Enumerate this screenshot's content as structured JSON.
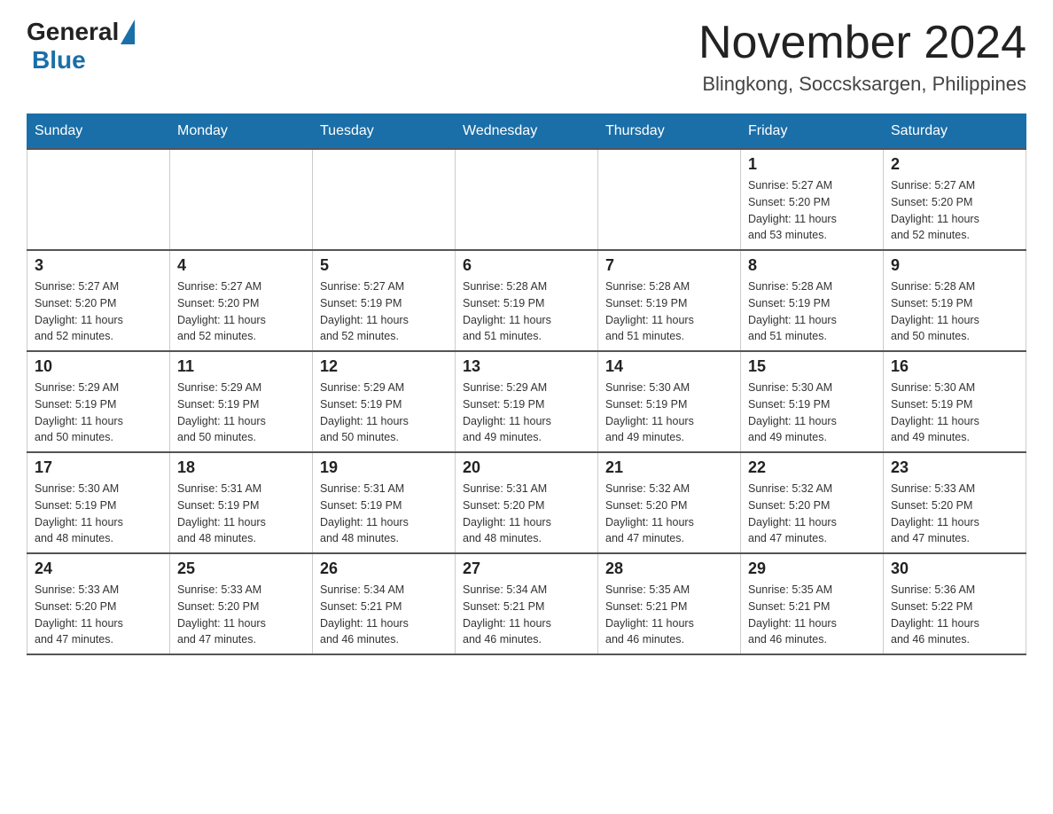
{
  "header": {
    "title": "November 2024",
    "subtitle": "Blingkong, Soccsksargen, Philippines",
    "logo_general": "General",
    "logo_blue": "Blue"
  },
  "weekdays": [
    "Sunday",
    "Monday",
    "Tuesday",
    "Wednesday",
    "Thursday",
    "Friday",
    "Saturday"
  ],
  "weeks": [
    [
      {
        "day": "",
        "info": ""
      },
      {
        "day": "",
        "info": ""
      },
      {
        "day": "",
        "info": ""
      },
      {
        "day": "",
        "info": ""
      },
      {
        "day": "",
        "info": ""
      },
      {
        "day": "1",
        "info": "Sunrise: 5:27 AM\nSunset: 5:20 PM\nDaylight: 11 hours\nand 53 minutes."
      },
      {
        "day": "2",
        "info": "Sunrise: 5:27 AM\nSunset: 5:20 PM\nDaylight: 11 hours\nand 52 minutes."
      }
    ],
    [
      {
        "day": "3",
        "info": "Sunrise: 5:27 AM\nSunset: 5:20 PM\nDaylight: 11 hours\nand 52 minutes."
      },
      {
        "day": "4",
        "info": "Sunrise: 5:27 AM\nSunset: 5:20 PM\nDaylight: 11 hours\nand 52 minutes."
      },
      {
        "day": "5",
        "info": "Sunrise: 5:27 AM\nSunset: 5:19 PM\nDaylight: 11 hours\nand 52 minutes."
      },
      {
        "day": "6",
        "info": "Sunrise: 5:28 AM\nSunset: 5:19 PM\nDaylight: 11 hours\nand 51 minutes."
      },
      {
        "day": "7",
        "info": "Sunrise: 5:28 AM\nSunset: 5:19 PM\nDaylight: 11 hours\nand 51 minutes."
      },
      {
        "day": "8",
        "info": "Sunrise: 5:28 AM\nSunset: 5:19 PM\nDaylight: 11 hours\nand 51 minutes."
      },
      {
        "day": "9",
        "info": "Sunrise: 5:28 AM\nSunset: 5:19 PM\nDaylight: 11 hours\nand 50 minutes."
      }
    ],
    [
      {
        "day": "10",
        "info": "Sunrise: 5:29 AM\nSunset: 5:19 PM\nDaylight: 11 hours\nand 50 minutes."
      },
      {
        "day": "11",
        "info": "Sunrise: 5:29 AM\nSunset: 5:19 PM\nDaylight: 11 hours\nand 50 minutes."
      },
      {
        "day": "12",
        "info": "Sunrise: 5:29 AM\nSunset: 5:19 PM\nDaylight: 11 hours\nand 50 minutes."
      },
      {
        "day": "13",
        "info": "Sunrise: 5:29 AM\nSunset: 5:19 PM\nDaylight: 11 hours\nand 49 minutes."
      },
      {
        "day": "14",
        "info": "Sunrise: 5:30 AM\nSunset: 5:19 PM\nDaylight: 11 hours\nand 49 minutes."
      },
      {
        "day": "15",
        "info": "Sunrise: 5:30 AM\nSunset: 5:19 PM\nDaylight: 11 hours\nand 49 minutes."
      },
      {
        "day": "16",
        "info": "Sunrise: 5:30 AM\nSunset: 5:19 PM\nDaylight: 11 hours\nand 49 minutes."
      }
    ],
    [
      {
        "day": "17",
        "info": "Sunrise: 5:30 AM\nSunset: 5:19 PM\nDaylight: 11 hours\nand 48 minutes."
      },
      {
        "day": "18",
        "info": "Sunrise: 5:31 AM\nSunset: 5:19 PM\nDaylight: 11 hours\nand 48 minutes."
      },
      {
        "day": "19",
        "info": "Sunrise: 5:31 AM\nSunset: 5:19 PM\nDaylight: 11 hours\nand 48 minutes."
      },
      {
        "day": "20",
        "info": "Sunrise: 5:31 AM\nSunset: 5:20 PM\nDaylight: 11 hours\nand 48 minutes."
      },
      {
        "day": "21",
        "info": "Sunrise: 5:32 AM\nSunset: 5:20 PM\nDaylight: 11 hours\nand 47 minutes."
      },
      {
        "day": "22",
        "info": "Sunrise: 5:32 AM\nSunset: 5:20 PM\nDaylight: 11 hours\nand 47 minutes."
      },
      {
        "day": "23",
        "info": "Sunrise: 5:33 AM\nSunset: 5:20 PM\nDaylight: 11 hours\nand 47 minutes."
      }
    ],
    [
      {
        "day": "24",
        "info": "Sunrise: 5:33 AM\nSunset: 5:20 PM\nDaylight: 11 hours\nand 47 minutes."
      },
      {
        "day": "25",
        "info": "Sunrise: 5:33 AM\nSunset: 5:20 PM\nDaylight: 11 hours\nand 47 minutes."
      },
      {
        "day": "26",
        "info": "Sunrise: 5:34 AM\nSunset: 5:21 PM\nDaylight: 11 hours\nand 46 minutes."
      },
      {
        "day": "27",
        "info": "Sunrise: 5:34 AM\nSunset: 5:21 PM\nDaylight: 11 hours\nand 46 minutes."
      },
      {
        "day": "28",
        "info": "Sunrise: 5:35 AM\nSunset: 5:21 PM\nDaylight: 11 hours\nand 46 minutes."
      },
      {
        "day": "29",
        "info": "Sunrise: 5:35 AM\nSunset: 5:21 PM\nDaylight: 11 hours\nand 46 minutes."
      },
      {
        "day": "30",
        "info": "Sunrise: 5:36 AM\nSunset: 5:22 PM\nDaylight: 11 hours\nand 46 minutes."
      }
    ]
  ]
}
